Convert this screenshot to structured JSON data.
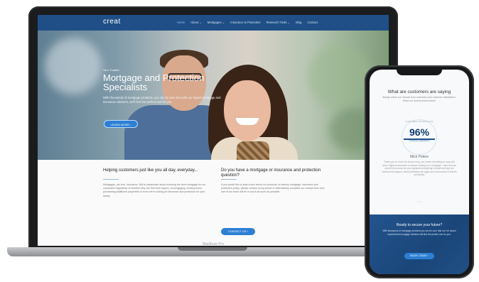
{
  "laptop": {
    "brand": "MacBook Pro"
  },
  "site": {
    "logo": "creat",
    "menu": [
      "Home",
      "About ⌄",
      "Mortgages ⌄",
      "Insurance & Protection",
      "Research Tools ⌄",
      "Blog",
      "Contact"
    ],
    "active_menu": "Home",
    "hero": {
      "eyebrow": "Your Trusted",
      "title": "Mortgage and Protection Specialists",
      "text": "With thousands of mortgage products, you can be sure that with our expert mortgage and insurance advisers, we'll find the perfect one for you.",
      "button": "LEARN MORE ›"
    },
    "left_col": {
      "title": "Helping customers just like you all day, everyday...",
      "text": "Mortgages, we love, insurance. We're passionate about ensuring the best mortgage for our customers regardless of whether they are first time buyers, remortgaging, moving home, purchasing additional properties or even we're looking at insurance and protection for your family."
    },
    "right_col": {
      "title": "Do you have a mortgage or insurance and protection question?",
      "text": "If you would like to learn more about our products or discuss mortgage, insurance and protection policy, please contact us by phone or alternatively complete our contact form and one of our team will be in touch as soon as possible.",
      "button": "CONTACT US ›"
    }
  },
  "phone": {
    "title": "What are customers are saying",
    "subtitle": "Always check our reviews from customers and customer satisfaction. Read our recent review below!",
    "ring_label": "CUSTOMER SATISFACTION",
    "percent": "96%",
    "percent_label": "Customer satisfaction",
    "quote_name": "Mick Peters",
    "quote_text": "Thank you so much for all your help, you made everything so easy and clear. Highly recommend to anyone looking for a mortgage. I was nervous about the process but you explained everything in detail and kept me informed throughout. Would definitely use again and recommend to friends and family.",
    "quote_arrows": "‹ ›",
    "band_title": "Ready to secure your future?",
    "band_text": "With thousands of mortgage products you can be sure that our UK based experienced mortgage advisers will find the perfect one for you.",
    "band_button": "BOOK TODAY ›"
  }
}
